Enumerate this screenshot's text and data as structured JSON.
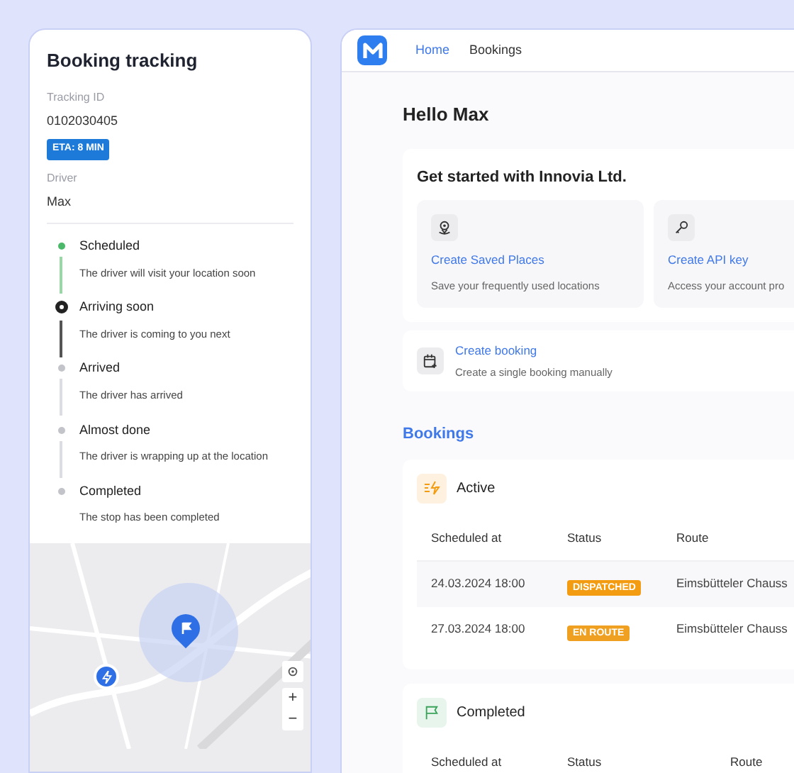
{
  "tracking": {
    "title": "Booking tracking",
    "fields": [
      {
        "label": "Tracking ID",
        "value": "0102030405"
      }
    ],
    "eta_badge": "ETA: 8 MIN",
    "driver": {
      "label": "Driver",
      "value": "Max"
    },
    "steps": [
      {
        "title": "Scheduled",
        "text": "The driver will visit your location soon",
        "kind": "done"
      },
      {
        "title": "Arriving soon",
        "text": "The driver is coming to you next",
        "kind": "current"
      },
      {
        "title": "Arrived",
        "text": "The driver has arrived",
        "kind": "upcoming"
      },
      {
        "title": "Almost done",
        "text": "The driver is wrapping up at the location",
        "kind": "upcoming"
      },
      {
        "title": "Completed",
        "text": "The stop has been completed",
        "kind": "upcoming"
      }
    ],
    "map_controls": {
      "zoom_in": "+",
      "zoom_out": "−"
    }
  },
  "nav": {
    "tabs": [
      {
        "label": "Home",
        "selected": true
      },
      {
        "label": "Bookings",
        "selected": false
      }
    ]
  },
  "greeting": "Hello Max",
  "get_started": {
    "title": "Get started with Innovia Ltd.",
    "cards": [
      {
        "kind": "places",
        "title": "Create Saved Places",
        "text": "Save your frequently used locations"
      },
      {
        "kind": "key",
        "title": "Create API key",
        "text": "Access your account pro"
      }
    ]
  },
  "create_booking": {
    "title": "Create booking",
    "text": "Create a single booking manually"
  },
  "bookings": {
    "title": "Bookings",
    "sections": [
      {
        "kind": "active",
        "title": "Active",
        "columns": [
          "Scheduled at",
          "Status",
          "Route"
        ],
        "rows": [
          {
            "scheduled": "24.03.2024 18:00",
            "status": "DISPATCHED",
            "route": "Eimsbütteler Chauss"
          },
          {
            "scheduled": "27.03.2024 18:00",
            "status": "EN ROUTE",
            "route": "Eimsbütteler Chauss"
          }
        ]
      },
      {
        "kind": "completed",
        "title": "Completed",
        "columns": [
          "Scheduled at",
          "Status",
          "Route"
        ]
      }
    ]
  }
}
